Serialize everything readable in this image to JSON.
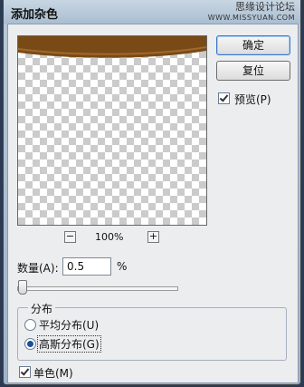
{
  "window": {
    "title": "添加杂色",
    "watermark_cn": "思缘设计论坛",
    "watermark_site": "WWW.MISSYUAN.COM"
  },
  "buttons": {
    "ok": "确定",
    "reset": "复位"
  },
  "preview_checkbox": {
    "label": "预览(P)",
    "checked": true
  },
  "zoom": {
    "minus": "−",
    "level": "100%",
    "plus": "+"
  },
  "amount": {
    "label": "数量(A):",
    "value": "0.5",
    "unit": "%",
    "slider_fraction": 0.0
  },
  "distribution": {
    "legend": "分布",
    "options": [
      {
        "label": "平均分布(U)",
        "selected": false
      },
      {
        "label": "高斯分布(G)",
        "selected": true
      }
    ]
  },
  "monochrome": {
    "label": "单色(M)",
    "checked": true
  },
  "colors": {
    "preview_brown": "#7a4a16"
  }
}
